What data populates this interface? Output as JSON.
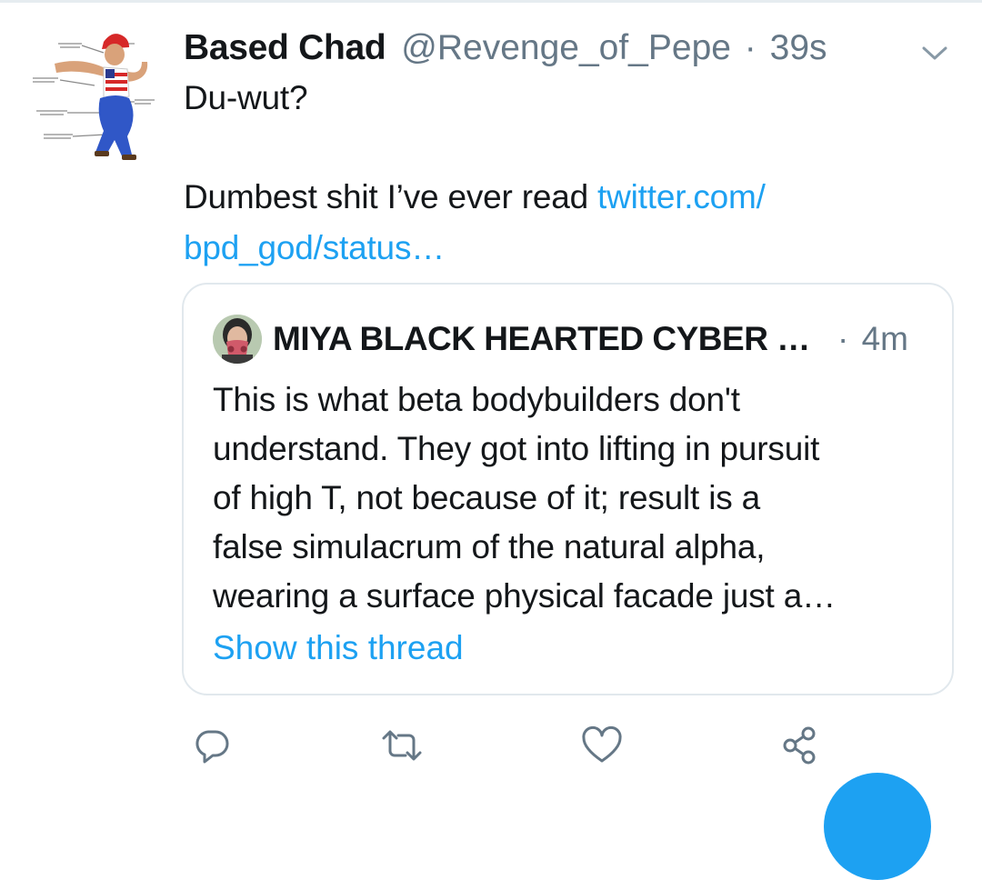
{
  "tweet": {
    "display_name": "Based Chad",
    "handle": "@Revenge_of_Pepe",
    "separator": "·",
    "time": "39s",
    "text_line1": "Du-wut?",
    "text_line2": "Dumbest shit I’ve ever read ",
    "link_part1": "twitter.com/",
    "link_part2": "bpd_god/status…"
  },
  "quote": {
    "display_name": "MIYA BLACK HEARTED CYBER …",
    "separator": "·",
    "time": "4m",
    "lines": [
      "This is what beta bodybuilders don't",
      "understand. They got into lifting in pursuit",
      "of high T, not because of it; result is a",
      "false simulacrum of the natural alpha,",
      "wearing a surface physical facade just a…"
    ],
    "show_thread": "Show this thread"
  },
  "icons": {
    "menu": "chevron-down-icon",
    "reply": "reply-icon",
    "retweet": "retweet-icon",
    "like": "heart-icon",
    "share": "share-icon",
    "compose": "compose-fab"
  },
  "colors": {
    "link": "#1da1f2",
    "secondary_text": "#657786",
    "border": "#e1e8ed"
  }
}
